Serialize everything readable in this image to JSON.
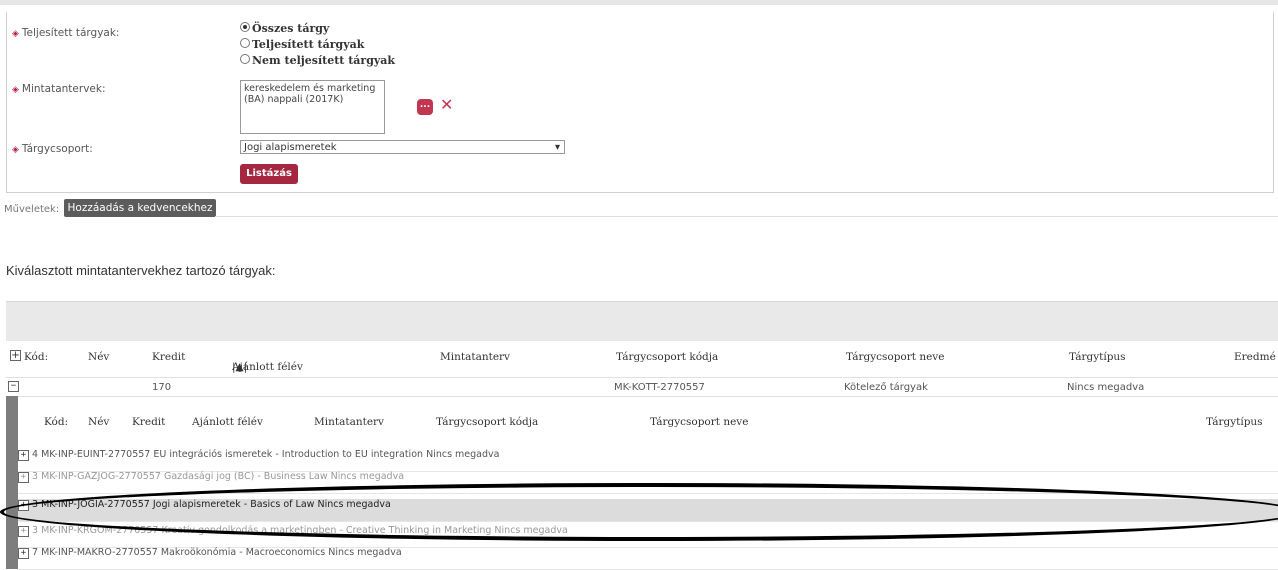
{
  "filter": {
    "completed_label": "Teljesített tárgyak:",
    "radio_options": [
      {
        "label": "Összes tárgy",
        "selected": true
      },
      {
        "label": "Teljesített tárgyak",
        "selected": false
      },
      {
        "label": "Nem teljesített tárgyak",
        "selected": false
      }
    ],
    "curricula_label": "Mintatantervek:",
    "curricula_value": "kereskedelem és marketing (BA) nappali (2017K)",
    "dots_label": "...",
    "remove_label": "✕",
    "group_label": "Tárgycsoport:",
    "group_selected": "Jogi alapismeretek",
    "list_button": "Listázás"
  },
  "actions": {
    "label": "Műveletek:",
    "add_favorite": "Hozzáadás a kedvencekhez"
  },
  "section_title": "Kiválasztott mintatantervekhez tartozó tárgyak:",
  "main_table": {
    "columns": [
      "Kód:",
      "Név",
      "Kredit",
      "Ajánlott félév",
      "Mintatanterv",
      "Tárgycsoport kódja",
      "Tárgycsoport neve",
      "Tárgytípus",
      "Eredmé"
    ],
    "sort_indicator": "|▲|",
    "group_row": {
      "kredit": "170",
      "group_code": "MK-KOTT-2770557",
      "group_name": "Kötelező tárgyak",
      "type": "Nincs megadva"
    }
  },
  "sub_table": {
    "columns": [
      "Kód:",
      "Név",
      "Kredit",
      "Ajánlott félév",
      "Mintatanterv",
      "Tárgycsoport kódja",
      "Tárgycsoport neve",
      "Tárgytípus"
    ],
    "rows": [
      {
        "kredit": "4",
        "code": "MK-INP-EUINT-2770557",
        "name": "EU integrációs ismeretek - Introduction to EU integration",
        "type": "Nincs megadva"
      },
      {
        "kredit": "3",
        "code": "MK-INP-GAZJOG-2770557",
        "name": "Gazdasági jog (BC) - Business Law",
        "type": "Nincs megadva"
      },
      {
        "kredit": "3",
        "code": "MK-INP-JOGIA-2770557",
        "name": "Jogi alapismeretek - Basics of Law",
        "type": "Nincs megadva"
      },
      {
        "kredit": "3",
        "code": "MK-INP-KRGOM-2770557",
        "name": "Kreatív gondolkodás a marketingben - Creative Thinking in Marketing",
        "type": "Nincs megadva"
      },
      {
        "kredit": "7",
        "code": "MK-INP-MAKRO-2770557",
        "name": "Makroökonómia - Macroeconomics",
        "type": "Nincs megadva"
      }
    ]
  }
}
